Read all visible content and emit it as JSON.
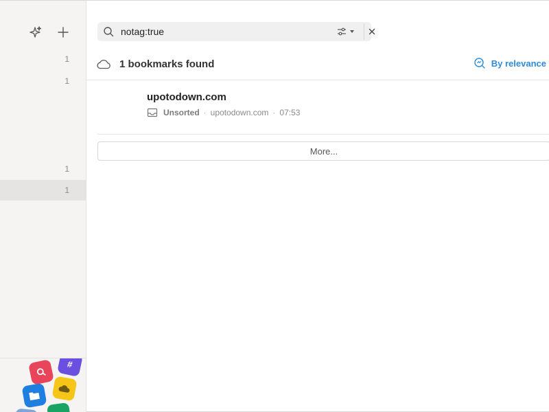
{
  "sidebar": {
    "ai_button_icon": "sparkle-icon",
    "add_button_icon": "plus-icon",
    "counts": [
      "1",
      "1",
      "1",
      "1"
    ],
    "app_icons": [
      "search-app-icon",
      "hashtag-app-icon",
      "folder-app-icon",
      "cloud-app-icon",
      "green-app-icon",
      "blue-app-icon"
    ]
  },
  "search": {
    "value": "notag:true",
    "icon": "search-icon",
    "filter_icon": "filter-settings-icon",
    "clear_icon": "close-icon"
  },
  "results": {
    "title": "1 bookmarks found",
    "icon": "cloud-icon",
    "sort_label": "By relevance",
    "sort_icon": "relevance-icon"
  },
  "bookmarks": [
    {
      "title": "upotodown.com",
      "collection": "Unsorted",
      "domain": "upotodown.com",
      "time": "07:53"
    }
  ],
  "more_label": "More...",
  "colors": {
    "accent": "#2f8ad8",
    "sidebar_bg": "#f5f4f3",
    "selected_row": "#e5e4e3"
  }
}
